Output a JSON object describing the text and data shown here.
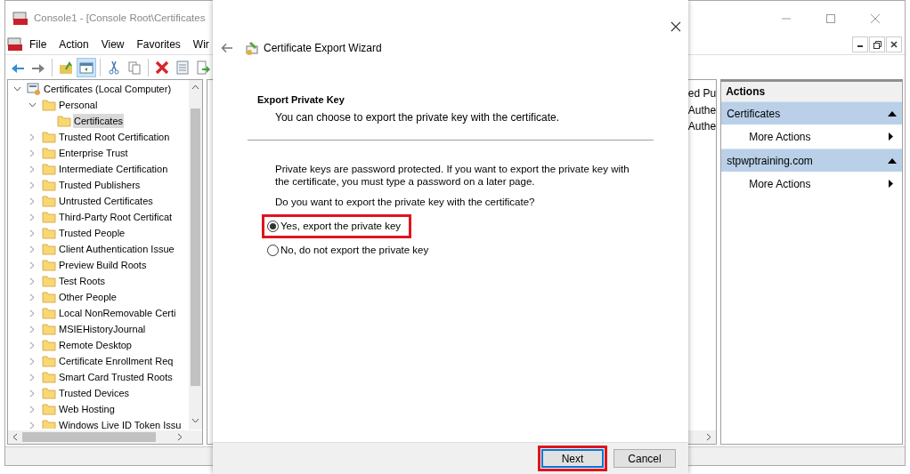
{
  "window": {
    "title": "Console1 - [Console Root\\Certificates"
  },
  "menu": [
    "File",
    "Action",
    "View",
    "Favorites",
    "Wir"
  ],
  "toolbar": [
    {
      "kind": "back",
      "selected": false
    },
    {
      "kind": "forward",
      "selected": false
    },
    {
      "kind": "sep"
    },
    {
      "kind": "up",
      "selected": false
    },
    {
      "kind": "tree",
      "selected": true
    },
    {
      "kind": "sep"
    },
    {
      "kind": "cut",
      "selected": false
    },
    {
      "kind": "copy",
      "selected": false
    },
    {
      "kind": "sep"
    },
    {
      "kind": "delete",
      "selected": false
    },
    {
      "kind": "properties",
      "selected": false
    },
    {
      "kind": "export",
      "selected": false
    }
  ],
  "tree": [
    {
      "label": "Certificates (Local Computer)",
      "kind": "store",
      "expanded": true,
      "selected": false,
      "children": [
        {
          "label": "Personal",
          "kind": "folder",
          "expanded": true,
          "selected": false,
          "children": [
            {
              "label": "Certificates",
              "kind": "folder",
              "selected": true
            }
          ]
        },
        {
          "label": "Trusted Root Certification",
          "kind": "folder",
          "expanded": false,
          "selected": false
        },
        {
          "label": "Enterprise Trust",
          "kind": "folder",
          "expanded": false,
          "selected": false
        },
        {
          "label": "Intermediate Certification",
          "kind": "folder",
          "expanded": false,
          "selected": false
        },
        {
          "label": "Trusted Publishers",
          "kind": "folder",
          "expanded": false,
          "selected": false
        },
        {
          "label": "Untrusted Certificates",
          "kind": "folder",
          "expanded": false,
          "selected": false
        },
        {
          "label": "Third-Party Root Certificat",
          "kind": "folder",
          "expanded": false,
          "selected": false
        },
        {
          "label": "Trusted People",
          "kind": "folder",
          "expanded": false,
          "selected": false
        },
        {
          "label": "Client Authentication Issue",
          "kind": "folder",
          "expanded": false,
          "selected": false
        },
        {
          "label": "Preview Build Roots",
          "kind": "folder",
          "expanded": false,
          "selected": false
        },
        {
          "label": "Test Roots",
          "kind": "folder",
          "expanded": false,
          "selected": false
        },
        {
          "label": "Other People",
          "kind": "folder",
          "expanded": false,
          "selected": false
        },
        {
          "label": "Local NonRemovable Certi",
          "kind": "folder",
          "expanded": false,
          "selected": false
        },
        {
          "label": "MSIEHistoryJournal",
          "kind": "folder",
          "expanded": false,
          "selected": false
        },
        {
          "label": "Remote Desktop",
          "kind": "folder",
          "expanded": false,
          "selected": false
        },
        {
          "label": "Certificate Enrollment Req",
          "kind": "folder",
          "expanded": false,
          "selected": false
        },
        {
          "label": "Smart Card Trusted Roots",
          "kind": "folder",
          "expanded": false,
          "selected": false
        },
        {
          "label": "Trusted Devices",
          "kind": "folder",
          "expanded": false,
          "selected": false
        },
        {
          "label": "Web Hosting",
          "kind": "folder",
          "expanded": false,
          "selected": false
        },
        {
          "label": "Windows Live ID Token Issu",
          "kind": "folder",
          "expanded": false,
          "selected": false
        }
      ]
    }
  ],
  "list": {
    "column_header": "ed Pu",
    "cells": [
      "Authe",
      "Authe"
    ]
  },
  "actions": {
    "title": "Actions",
    "sections": [
      {
        "label": "Certificates",
        "expanded": true,
        "items": [
          "More Actions"
        ]
      },
      {
        "label": "stpwptraining.com",
        "expanded": true,
        "items": [
          "More Actions"
        ]
      }
    ]
  },
  "dialog": {
    "title": "Certificate Export Wizard",
    "heading": "Export Private Key",
    "subheading": "You can choose to export the private key with the certificate.",
    "description": "Private keys are password protected. If you want to export the private key with the certificate, you must type a password on a later page.",
    "question": "Do you want to export the private key with the certificate?",
    "options": [
      {
        "label": "Yes, export the private key",
        "selected": true,
        "highlighted": true
      },
      {
        "label": "No, do not export the private key",
        "selected": false,
        "highlighted": false
      }
    ],
    "buttons": [
      {
        "label": "Next",
        "default": true,
        "highlighted": true
      },
      {
        "label": "Cancel",
        "default": false,
        "highlighted": false
      }
    ]
  }
}
